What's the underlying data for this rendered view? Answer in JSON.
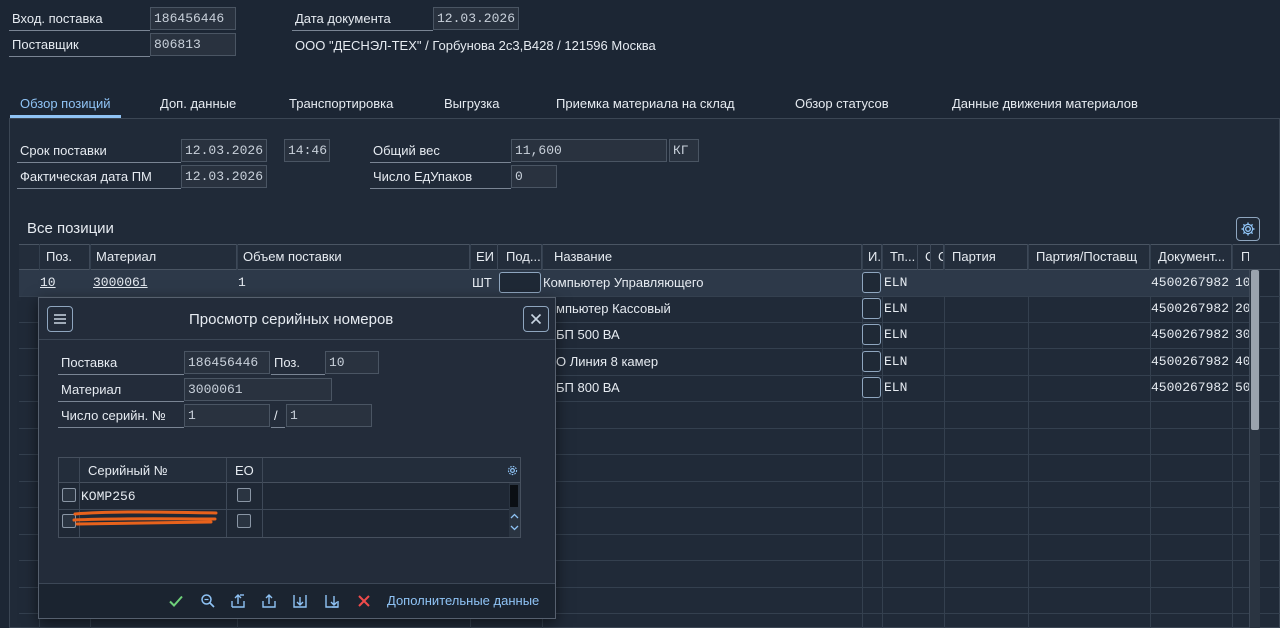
{
  "header": {
    "inbound_label": "Вход. поставка",
    "inbound_value": "186456446",
    "docdate_label": "Дата документа",
    "docdate_value": "12.03.2026",
    "vendor_label": "Поставщик",
    "vendor_value": "806813",
    "vendor_address": "ООО \"ДЕСНЭЛ-ТЕХ\" / Горбунова 2с3,В428 / 121596 Москва"
  },
  "tabs": [
    {
      "label": "Обзор позиций",
      "active": true
    },
    {
      "label": "Доп. данные"
    },
    {
      "label": "Транспортировка"
    },
    {
      "label": "Выгрузка"
    },
    {
      "label": "Приемка материала на склад"
    },
    {
      "label": "Обзор статусов"
    },
    {
      "label": "Данные движения материалов"
    }
  ],
  "overview": {
    "delivery_date_label": "Срок поставки",
    "delivery_date": "12.03.2026",
    "delivery_time": "14:46",
    "actual_gr_label": "Фактическая дата ПМ",
    "actual_gr_date": "12.03.2026",
    "total_weight_label": "Общий вес",
    "total_weight": "11,600",
    "weight_unit": "КГ",
    "packages_label": "Число ЕдУпаков",
    "packages": "0"
  },
  "items": {
    "title": "Все позиции",
    "columns": [
      "Поз.",
      "Материал",
      "Объем поставки",
      "ЕИ",
      "Под...",
      "Название",
      "И.",
      "Тп...",
      "С",
      "С",
      "Партия",
      "Партия/Поставщ",
      "Документ...",
      "П"
    ],
    "rows": [
      {
        "pos": "10",
        "material": "3000061",
        "qty": "1",
        "uom": "ШТ",
        "name": "Компьютер Управляющего",
        "type": "ELN",
        "doc": "4500267982",
        "docpos": "10"
      },
      {
        "name": "мпьютер Кассовый",
        "type": "ELN",
        "doc": "4500267982",
        "docpos": "20"
      },
      {
        "name": "БП 500 ВА",
        "type": "ELN",
        "doc": "4500267982",
        "docpos": "30"
      },
      {
        "name": "О Линия 8 камер",
        "type": "ELN",
        "doc": "4500267982",
        "docpos": "40"
      },
      {
        "name": "БП 800 ВА",
        "type": "ELN",
        "doc": "4500267982",
        "docpos": "50"
      }
    ]
  },
  "dialog": {
    "title": "Просмотр серийных номеров",
    "delivery_label": "Поставка",
    "delivery_value": "186456446",
    "pos_label": "Поз.",
    "pos_value": "10",
    "material_label": "Материал",
    "material_value": "3000061",
    "serial_count_label": "Число серийн. №",
    "serial_count": "1",
    "slash": "/",
    "serial_total": "1",
    "table": {
      "col_serial": "Серийный №",
      "col_eo": "ЕО",
      "rows": [
        {
          "serial": "KOMP256"
        },
        {
          "serial": ""
        }
      ]
    },
    "footer": {
      "more_data": "Дополнительные данные"
    }
  }
}
